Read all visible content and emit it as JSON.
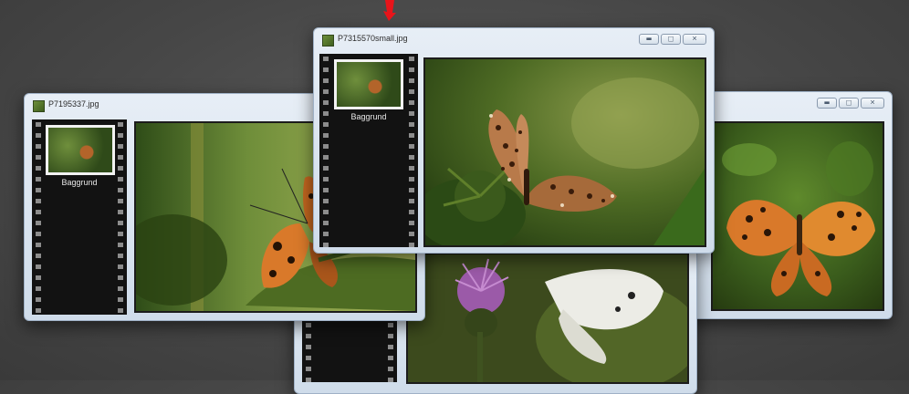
{
  "windows": {
    "left": {
      "title": "P7195337.jpg",
      "thumb_label": "Baggrund"
    },
    "center": {
      "title": "P7315570small.jpg",
      "thumb_label": "Baggrund"
    },
    "right": {
      "title": ""
    },
    "bottom": {
      "title": ""
    }
  },
  "icons": {
    "minimize": "minimize-icon",
    "maximize": "maximize-icon",
    "close": "close-icon",
    "pointer": "red-arrow-pointer"
  },
  "colors": {
    "desktop_bg": "#474747",
    "window_chrome": "#dde6f0",
    "filmstrip": "#121212",
    "pointer_red": "#e8141a"
  }
}
